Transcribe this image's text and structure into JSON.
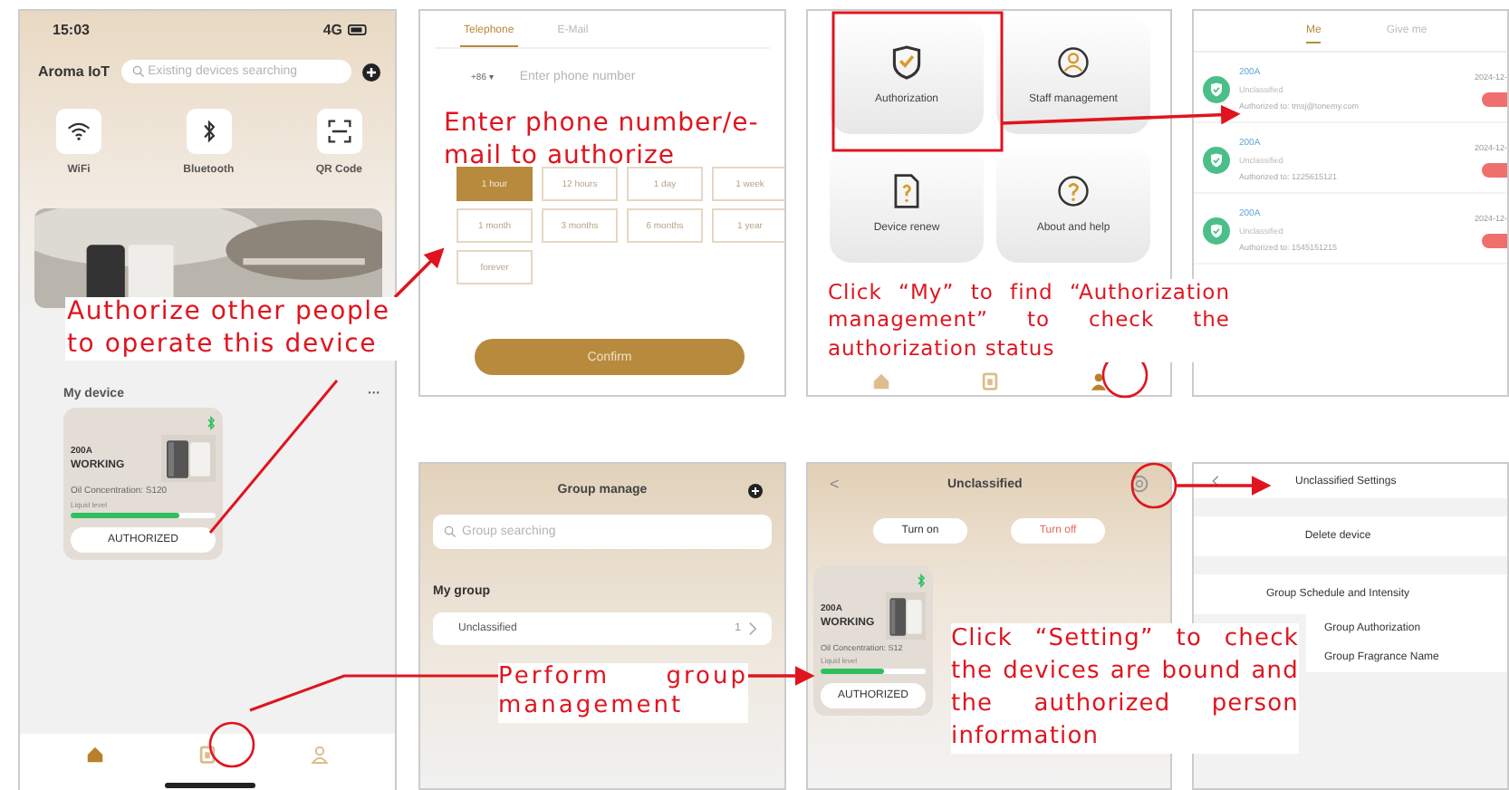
{
  "home": {
    "status_time": "15:03",
    "network": "4G",
    "title": "Aroma IoT",
    "search": {
      "placeholder": "Existing devices searching"
    },
    "quick_actions": [
      {
        "kind": "wifi",
        "label": "WiFi"
      },
      {
        "kind": "bluetooth",
        "label": "Bluetooth"
      },
      {
        "kind": "qr",
        "label": "QR Code"
      }
    ],
    "section_title": "My device",
    "section_menu": "···",
    "device": {
      "id": "200A",
      "state": "WORKING",
      "detail": "Oil Concentration: S120",
      "level_label": "Liquid level",
      "level": 0.75,
      "button": "AUTHORIZED"
    },
    "nav": [
      {
        "kind": "home",
        "selected": true
      },
      {
        "kind": "devices",
        "selected": false
      },
      {
        "kind": "user",
        "selected": false
      }
    ]
  },
  "share": {
    "tabs": [
      {
        "label": "Telephone",
        "selected": true
      },
      {
        "label": "E-Mail",
        "selected": false
      }
    ],
    "country_code": "+86 ▾",
    "phone": {
      "placeholder": "Enter phone number"
    },
    "times": [
      {
        "label": "1 hour",
        "selected": true
      },
      {
        "label": "12 hours",
        "selected": false
      },
      {
        "label": "1 day",
        "selected": false
      },
      {
        "label": "1 week",
        "selected": false
      },
      {
        "label": "1 month",
        "selected": false
      },
      {
        "label": "3 months",
        "selected": false
      },
      {
        "label": "6 months",
        "selected": false
      },
      {
        "label": "1 year",
        "selected": false
      },
      {
        "label": "forever",
        "selected": false
      }
    ],
    "confirm": "Confirm"
  },
  "my": {
    "tiles": [
      {
        "kind": "shield",
        "label": "Authorization"
      },
      {
        "kind": "person",
        "label": "Staff management"
      },
      {
        "kind": "document",
        "label": "Device renew"
      },
      {
        "kind": "help",
        "label": "About and help"
      }
    ],
    "nav": [
      {
        "kind": "home",
        "selected": false
      },
      {
        "kind": "devices",
        "selected": false
      },
      {
        "kind": "user",
        "selected": true
      }
    ]
  },
  "authorizations": {
    "tabs": [
      {
        "label": "Me",
        "selected": true
      },
      {
        "label": "Give me",
        "selected": false
      }
    ],
    "records": [
      {
        "device": "200A",
        "group": "Unclassified",
        "authorized_to": "Authorized to: tmsj@tonemy.com",
        "date": "2024-12-"
      },
      {
        "device": "200A",
        "group": "Unclassified",
        "authorized_to": "Authorized to: 1225615121",
        "date": "2024-12-"
      },
      {
        "device": "200A",
        "group": "Unclassified",
        "authorized_to": "Authorized to: 1545151215",
        "date": "2024-12-"
      }
    ]
  },
  "groups": {
    "title": "Group manage",
    "search": {
      "placeholder": "Group searching"
    },
    "section_title": "My group",
    "rows": [
      {
        "name": "Unclassified",
        "count": "1"
      }
    ]
  },
  "group_detail": {
    "back": "<",
    "title": "Unclassified",
    "buttons": [
      {
        "kind": "on",
        "label": "Turn on"
      },
      {
        "kind": "off",
        "label": "Turn off"
      }
    ],
    "device": {
      "id": "200A",
      "state": "WORKING",
      "detail": "Oil Concentration: S12",
      "level_label": "Liquid level",
      "level": 0.6,
      "button": "AUTHORIZED"
    }
  },
  "group_settings": {
    "title": "Unclassified Settings",
    "items": [
      "Delete device",
      "Group Schedule and Intensity",
      "Group Authorization",
      "Group Fragrance Name"
    ]
  },
  "annotations": [
    "Authorize other people to operate this device",
    "Enter phone number/e-mail to authorize",
    "Click “My” to find “Authorization management” to check the authorization status",
    "Perform group management",
    "Click “Setting” to check the devices are bound and the authorized person information"
  ]
}
